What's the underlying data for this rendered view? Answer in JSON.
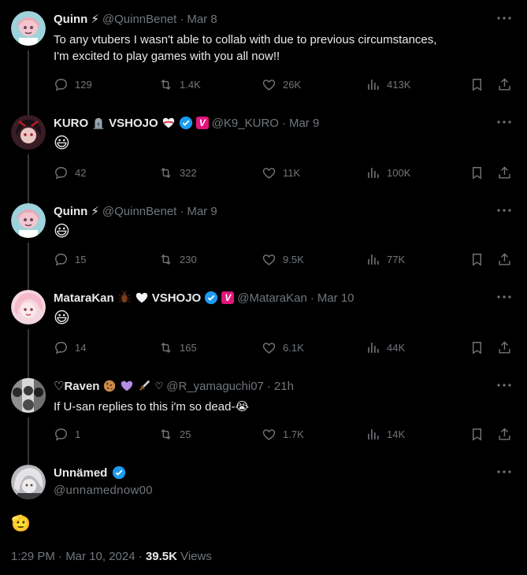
{
  "colors": {
    "background": "#000000",
    "text": "#e7e9ea",
    "muted": "#71767b",
    "verified": "#1d9bf0",
    "vshojo": "#e1157b"
  },
  "replies": [
    {
      "name": "Quinn",
      "name_emoji": "⚡",
      "handle": "@QuinnBenet",
      "sep": "·",
      "time": "Mar 8",
      "text_lines": [
        "To any vtubers I wasn't able to collab with due to previous circumstances,",
        "I'm excited to play games with you all now!!"
      ],
      "stats": {
        "replies": "129",
        "reposts": "1.4K",
        "likes": "26K",
        "views": "413K"
      }
    },
    {
      "name": "KURO",
      "name_suffix": "VSHOJO",
      "handle": "@K9_KURO",
      "sep": "·",
      "time": "Mar 9",
      "text": "😃",
      "stats": {
        "replies": "42",
        "reposts": "322",
        "likes": "11K",
        "views": "100K"
      }
    },
    {
      "name": "Quinn",
      "name_emoji": "⚡",
      "handle": "@QuinnBenet",
      "sep": "·",
      "time": "Mar 9",
      "text": "😃",
      "stats": {
        "replies": "15",
        "reposts": "230",
        "likes": "9.5K",
        "views": "77K"
      }
    },
    {
      "name": "MataraKan",
      "name_suffix": "VSHOJO",
      "handle": "@MataraKan",
      "sep": "·",
      "time": "Mar 10",
      "text": "😃",
      "stats": {
        "replies": "14",
        "reposts": "165",
        "likes": "6.1K",
        "views": "44K"
      }
    },
    {
      "name": "♡Raven",
      "handle": "@R_yamaguchi07",
      "sep": "·",
      "time": "21h",
      "text": "If U-san replies to this i'm so dead-😭",
      "stats": {
        "replies": "1",
        "reposts": "25",
        "likes": "1.7K",
        "views": "14K"
      }
    }
  ],
  "main": {
    "name": "Unnämed",
    "handle": "@unnamednow00",
    "text": "🫡",
    "timestamp": "1:29 PM · Mar 10, 2024 · ",
    "views_count": "39.5K",
    "views_label": " Views"
  },
  "icons": [
    "more-icon",
    "reply-icon",
    "repost-icon",
    "like-icon",
    "views-icon",
    "bookmark-icon",
    "share-icon",
    "verified-icon"
  ]
}
